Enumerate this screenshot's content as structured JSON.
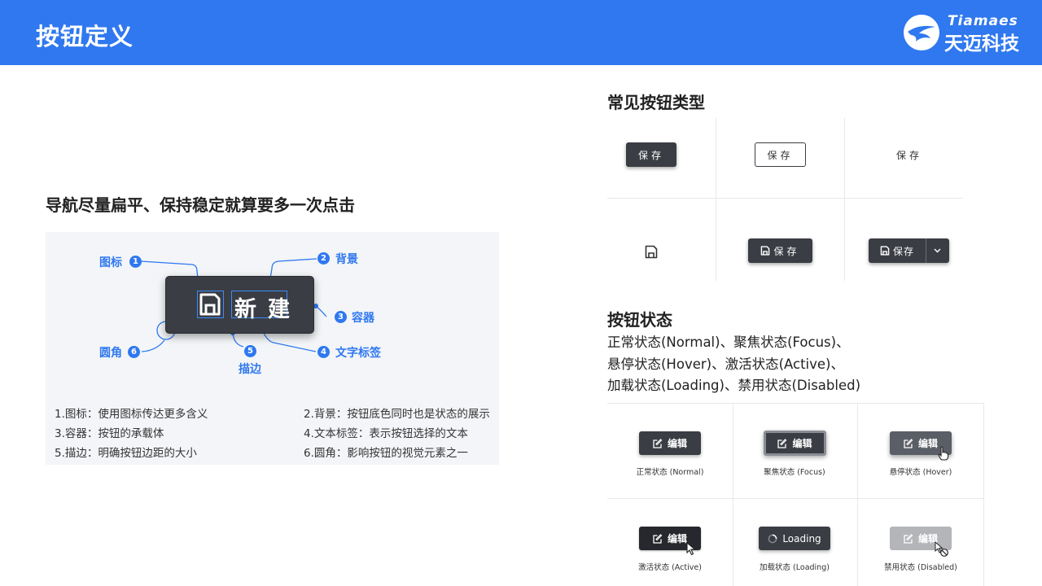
{
  "header": {
    "title": "按钮定义",
    "logo_en": "Tiamaes",
    "logo_cn": "天迈科技"
  },
  "left": {
    "heading": "导航尽量扁平、保持稳定就算要多一次点击",
    "button_label": "新建",
    "callouts": [
      {
        "num": "1",
        "label": "图标"
      },
      {
        "num": "2",
        "label": "背景"
      },
      {
        "num": "3",
        "label": "容器"
      },
      {
        "num": "4",
        "label": "文字标签"
      },
      {
        "num": "5",
        "label": "描边"
      },
      {
        "num": "6",
        "label": "圆角"
      }
    ],
    "notes": [
      "1.图标：使用图标传达更多含义",
      "2.背景：按钮底色同时也是状态的展示",
      "3.容器：按钮的承载体",
      "4.文本标签：表示按钮选择的文本",
      "5.描边：明确按钮边距的大小",
      "6.圆角：影响按钮的视觉元素之一"
    ]
  },
  "types": {
    "heading": "常见按钮类型",
    "save_label": "保存",
    "split_label": "保存"
  },
  "states": {
    "heading": "按钮状态",
    "desc_lines": [
      "正常状态(Normal)、聚焦状态(Focus)、",
      "悬停状态(Hover)、激活状态(Active)、",
      "加载状态(Loading)、禁用状态(Disabled)"
    ],
    "edit_label": "编辑",
    "loading_label": "Loading",
    "captions": [
      "正常状态 (Normal)",
      "聚焦状态 (Focus)",
      "悬停状态 (Hover)",
      "激活状态 (Active)",
      "加载状态 (Loading)",
      "禁用状态 (Disabled)"
    ]
  },
  "colors": {
    "brand": "#2f78ef",
    "button_dark": "#3a3d44",
    "button_hover": "#5a5e66",
    "button_active": "#26282d",
    "button_disabled": "#b3b5b9",
    "panel_bg": "#f3f5f8"
  }
}
